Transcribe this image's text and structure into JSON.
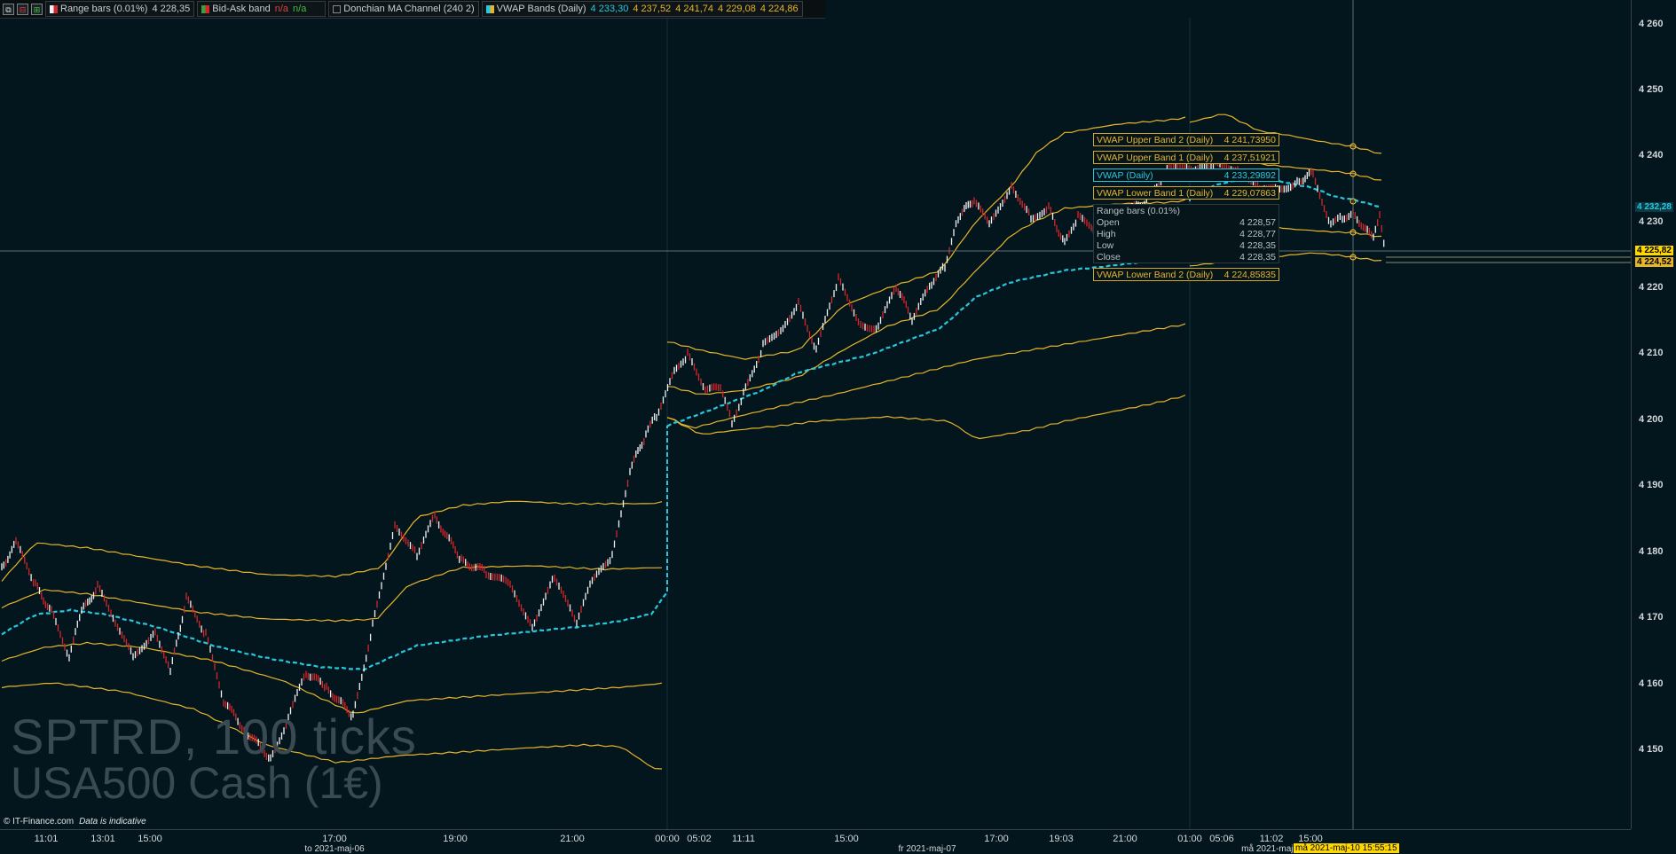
{
  "topbar": {
    "range_bars_label": "Range bars (0.01%)",
    "range_bars_value": "4 228,35",
    "bidask_label": "Bid-Ask band",
    "bidask_v1": "n/a",
    "bidask_v2": "n/a",
    "donchian_label": "Donchian MA Channel (240 2)",
    "vwap_label": "VWAP Bands (Daily)",
    "vwap_v1": "4 233,30",
    "vwap_v2": "4 237,52",
    "vwap_v3": "4 241,74",
    "vwap_v4": "4 229,08",
    "vwap_v5": "4 224,86"
  },
  "colors": {
    "background": "#04161d",
    "band": "#e7b52a",
    "vwap": "#25c8df",
    "up_bar": "#f2f2f2",
    "down_bar": "#d4262b",
    "cursor_tag": "#ffd800"
  },
  "yaxis": {
    "ticks": [
      "4 260",
      "4 250",
      "4 240",
      "4 230",
      "4 220",
      "4 210",
      "4 200",
      "4 190",
      "4 180",
      "4 170",
      "4 160",
      "4 150"
    ],
    "tag_vwap": "4 232,28",
    "tag_cursor": "4 225,82",
    "tag_price": "4 224,52"
  },
  "xaxis": {
    "ticks": [
      "11:01",
      "13:01",
      "15:00",
      "17:00",
      "19:00",
      "21:00",
      "00:00",
      "05:02",
      "11:11",
      "15:00",
      "17:00",
      "19:03",
      "21:00",
      "01:00",
      "05:06",
      "11:02",
      "15:00"
    ],
    "dates": [
      "to 2021-maj-06",
      "fr 2021-maj-07",
      "må 2021-maj-"
    ],
    "cursor_label": "må 2021-maj-10 15:55:15"
  },
  "tooltip": {
    "upper2_label": "VWAP Upper Band 2 (Daily)",
    "upper2_value": "4 241,73950",
    "upper1_label": "VWAP Upper Band 1 (Daily)",
    "upper1_value": "4 237,51921",
    "vwap_label": "VWAP (Daily)",
    "vwap_value": "4 233,29892",
    "lower1_label": "VWAP Lower Band 1 (Daily)",
    "lower1_value": "4 229,07863",
    "lower2_label": "VWAP Lower Band 2 (Daily)",
    "lower2_value": "4 224,85835",
    "ohlc_title": "Range bars (0.01%)",
    "open_label": "Open",
    "open_value": "4 228,57",
    "high_label": "High",
    "high_value": "4 228,77",
    "low_label": "Low",
    "low_value": "4 228,35",
    "close_label": "Close",
    "close_value": "4 228,35"
  },
  "watermark": {
    "line1": "SPTRD, 100 ticks",
    "line2": "USA500 Cash (1€)"
  },
  "footer": {
    "copyright": "© IT-Finance.com",
    "note": "Data is indicative"
  }
}
